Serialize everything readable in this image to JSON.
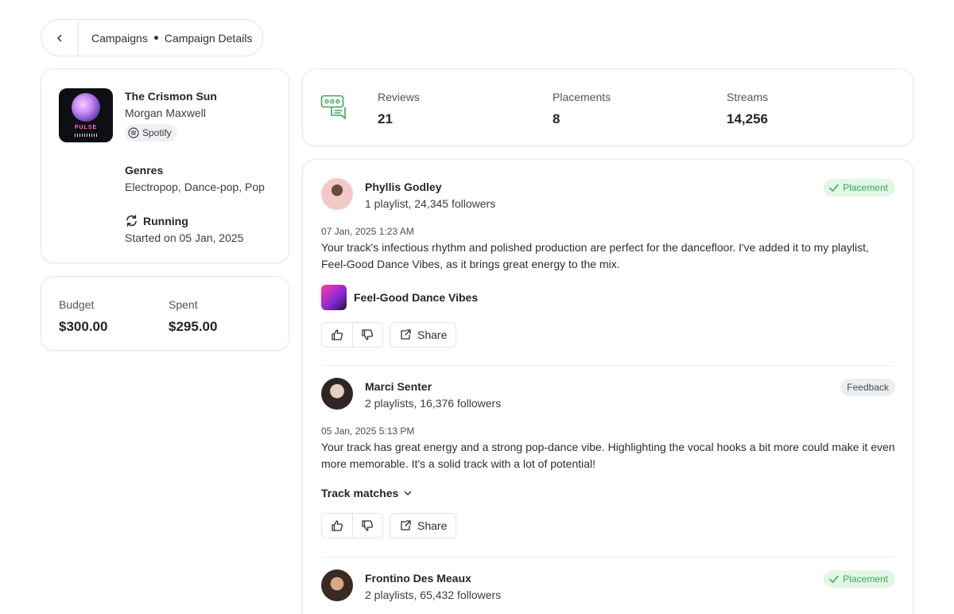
{
  "breadcrumb": {
    "root": "Campaigns",
    "current": "Campaign Details"
  },
  "track": {
    "cover_text": "PULSE",
    "title": "The Crismon Sun",
    "artist": "Morgan Maxwell",
    "platform": "Spotify",
    "genres_label": "Genres",
    "genres": "Electropop, Dance-pop, Pop",
    "status": "Running",
    "started": "Started on 05 Jan, 2025"
  },
  "budget": {
    "budget_label": "Budget",
    "budget_value": "$300.00",
    "spent_label": "Spent",
    "spent_value": "$295.00"
  },
  "stats": {
    "reviews_label": "Reviews",
    "reviews_value": "21",
    "placements_label": "Placements",
    "placements_value": "8",
    "streams_label": "Streams",
    "streams_value": "14,256"
  },
  "reviews": [
    {
      "name": "Phyllis Godley",
      "sub": "1 playlist, 24,345 followers",
      "badge": "Placement",
      "date": "07 Jan, 2025 1:23 AM",
      "text": "Your track's infectious rhythm and polished production are perfect for the dancefloor. I've added it to my playlist, Feel-Good Dance Vibes, as it brings great energy to the mix.",
      "playlist": "Feel-Good Dance Vibes",
      "share": "Share"
    },
    {
      "name": "Marci Senter",
      "sub": "2 playlists, 16,376 followers",
      "badge": "Feedback",
      "date": "05 Jan, 2025 5:13 PM",
      "text": "Your track has great energy and a strong pop-dance vibe. Highlighting the vocal hooks a bit more could make it even more memorable. It's a solid track with a lot of potential!",
      "matches": "Track matches",
      "share": "Share"
    },
    {
      "name": "Frontino Des Meaux",
      "sub": "2 playlists, 65,432 followers",
      "badge": "Placement"
    }
  ],
  "colors": {
    "accent_green": "#3aa657",
    "badge_green_bg": "#e2f7e6"
  }
}
